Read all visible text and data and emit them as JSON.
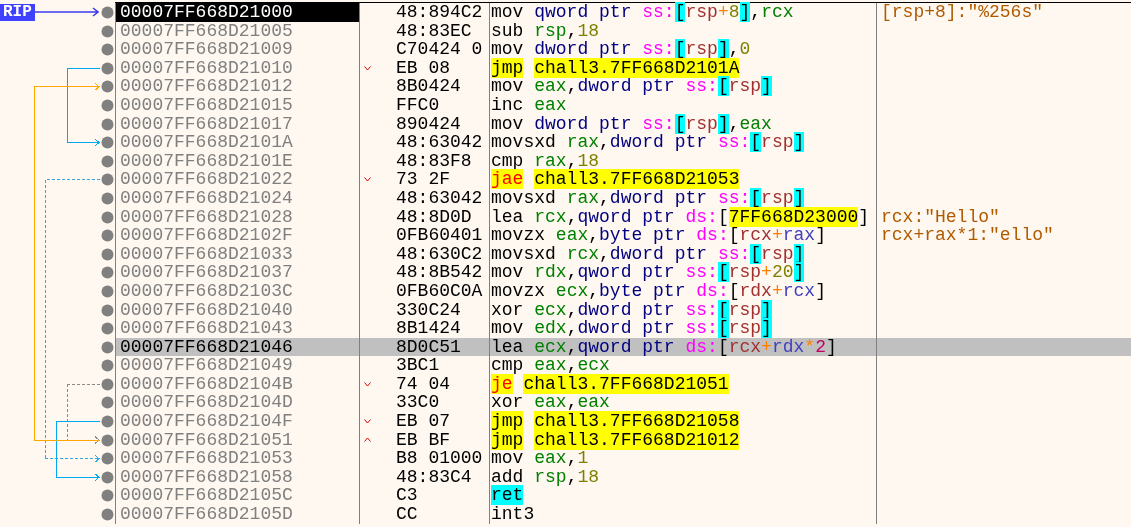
{
  "rows": [
    {
      "label": "RIP",
      "address": "00007FF668D21000",
      "bytes": "48:894C2",
      "selected": true,
      "highlighted": false,
      "tokens": [
        {
          "kind": "m",
          "text": "mov"
        },
        {
          "kind": "sz",
          "text": "qword ptr"
        },
        {
          "kind": "seg",
          "text": "ss:"
        },
        {
          "kind": "bk",
          "text": "["
        },
        {
          "kind": "base",
          "text": "rsp"
        },
        {
          "kind": "op",
          "text": "+"
        },
        {
          "kind": "num",
          "text": "8"
        },
        {
          "kind": "bk",
          "text": "]"
        },
        {
          "kind": "p",
          "text": ","
        },
        {
          "kind": "reg",
          "text": "rcx"
        }
      ],
      "comment": "[rsp+8]:\"%256s\""
    },
    {
      "address": "00007FF668D21005",
      "bytes": "48:83EC",
      "selected": false,
      "highlighted": false,
      "tokens": [
        {
          "kind": "m",
          "text": "sub"
        },
        {
          "kind": "reg",
          "text": "rsp"
        },
        {
          "kind": "p",
          "text": ","
        },
        {
          "kind": "num",
          "text": "18"
        }
      ]
    },
    {
      "address": "00007FF668D21009",
      "bytes": "C70424 0",
      "selected": false,
      "highlighted": false,
      "tokens": [
        {
          "kind": "m",
          "text": "mov"
        },
        {
          "kind": "sz",
          "text": "dword ptr"
        },
        {
          "kind": "seg",
          "text": "ss:"
        },
        {
          "kind": "bk",
          "text": "["
        },
        {
          "kind": "base",
          "text": "rsp"
        },
        {
          "kind": "bk",
          "text": "]"
        },
        {
          "kind": "p",
          "text": ","
        },
        {
          "kind": "num",
          "text": "0"
        }
      ]
    },
    {
      "address": "00007FF668D21010",
      "bytes": "EB 08",
      "selected": false,
      "highlighted": false,
      "jump": {
        "dashed": false,
        "color": "#00a8f0"
      },
      "tokens": [
        {
          "kind": "jmp",
          "text": "jmp"
        },
        {
          "kind": "tgt",
          "text": "chall3.7FF668D2101A"
        }
      ]
    },
    {
      "address": "00007FF668D21012",
      "bytes": "8B0424",
      "selected": false,
      "highlighted": false,
      "tokens": [
        {
          "kind": "m",
          "text": "mov"
        },
        {
          "kind": "reg",
          "text": "eax"
        },
        {
          "kind": "p",
          "text": ","
        },
        {
          "kind": "sz",
          "text": "dword ptr"
        },
        {
          "kind": "seg",
          "text": "ss:"
        },
        {
          "kind": "bk",
          "text": "["
        },
        {
          "kind": "base",
          "text": "rsp"
        },
        {
          "kind": "bk",
          "text": "]"
        }
      ]
    },
    {
      "address": "00007FF668D21015",
      "bytes": "FFC0",
      "selected": false,
      "highlighted": false,
      "tokens": [
        {
          "kind": "m",
          "text": "inc"
        },
        {
          "kind": "reg",
          "text": "eax"
        }
      ]
    },
    {
      "address": "00007FF668D21017",
      "bytes": "890424",
      "selected": false,
      "highlighted": false,
      "tokens": [
        {
          "kind": "m",
          "text": "mov"
        },
        {
          "kind": "sz",
          "text": "dword ptr"
        },
        {
          "kind": "seg",
          "text": "ss:"
        },
        {
          "kind": "bk",
          "text": "["
        },
        {
          "kind": "base",
          "text": "rsp"
        },
        {
          "kind": "bk",
          "text": "]"
        },
        {
          "kind": "p",
          "text": ","
        },
        {
          "kind": "reg",
          "text": "eax"
        }
      ]
    },
    {
      "address": "00007FF668D2101A",
      "bytes": "48:63042",
      "selected": false,
      "highlighted": false,
      "tokens": [
        {
          "kind": "m",
          "text": "movsxd"
        },
        {
          "kind": "reg",
          "text": "rax"
        },
        {
          "kind": "p",
          "text": ","
        },
        {
          "kind": "sz",
          "text": "dword ptr"
        },
        {
          "kind": "seg",
          "text": "ss:"
        },
        {
          "kind": "bk",
          "text": "["
        },
        {
          "kind": "base",
          "text": "rsp"
        },
        {
          "kind": "bk",
          "text": "]"
        }
      ]
    },
    {
      "address": "00007FF668D2101E",
      "bytes": "48:83F8",
      "selected": false,
      "highlighted": false,
      "tokens": [
        {
          "kind": "m",
          "text": "cmp"
        },
        {
          "kind": "reg",
          "text": "rax"
        },
        {
          "kind": "p",
          "text": ","
        },
        {
          "kind": "num",
          "text": "18"
        }
      ]
    },
    {
      "address": "00007FF668D21022",
      "bytes": "73 2F",
      "selected": false,
      "highlighted": false,
      "jump": {
        "dashed": true,
        "color": "#30a8e8"
      },
      "tokens": [
        {
          "kind": "jcc",
          "text": "jae"
        },
        {
          "kind": "tgt",
          "text": "chall3.7FF668D21053"
        }
      ]
    },
    {
      "address": "00007FF668D21024",
      "bytes": "48:63042",
      "selected": false,
      "highlighted": false,
      "tokens": [
        {
          "kind": "m",
          "text": "movsxd"
        },
        {
          "kind": "reg",
          "text": "rax"
        },
        {
          "kind": "p",
          "text": ","
        },
        {
          "kind": "sz",
          "text": "dword ptr"
        },
        {
          "kind": "seg",
          "text": "ss:"
        },
        {
          "kind": "bk",
          "text": "["
        },
        {
          "kind": "base",
          "text": "rsp"
        },
        {
          "kind": "bk",
          "text": "]"
        }
      ]
    },
    {
      "address": "00007FF668D21028",
      "bytes": "48:8D0D",
      "selected": false,
      "highlighted": false,
      "tokens": [
        {
          "kind": "m",
          "text": "lea"
        },
        {
          "kind": "reg",
          "text": "rcx"
        },
        {
          "kind": "p",
          "text": ","
        },
        {
          "kind": "sz",
          "text": "qword ptr"
        },
        {
          "kind": "seg",
          "text": "ds:"
        },
        {
          "kind": "b",
          "text": "["
        },
        {
          "kind": "addr",
          "text": "7FF668D23000"
        },
        {
          "kind": "b",
          "text": "]"
        }
      ],
      "comment": "rcx:\"Hello\""
    },
    {
      "address": "00007FF668D2102F",
      "bytes": "0FB60401",
      "selected": false,
      "highlighted": false,
      "tokens": [
        {
          "kind": "m",
          "text": "movzx"
        },
        {
          "kind": "reg",
          "text": "eax"
        },
        {
          "kind": "p",
          "text": ","
        },
        {
          "kind": "sz",
          "text": "byte ptr"
        },
        {
          "kind": "seg",
          "text": "ds:"
        },
        {
          "kind": "b",
          "text": "["
        },
        {
          "kind": "base",
          "text": "rcx"
        },
        {
          "kind": "op",
          "text": "+"
        },
        {
          "kind": "idx",
          "text": "rax"
        },
        {
          "kind": "b",
          "text": "]"
        }
      ],
      "comment": "rcx+rax*1:\"ello\""
    },
    {
      "address": "00007FF668D21033",
      "bytes": "48:630C2",
      "selected": false,
      "highlighted": false,
      "tokens": [
        {
          "kind": "m",
          "text": "movsxd"
        },
        {
          "kind": "reg",
          "text": "rcx"
        },
        {
          "kind": "p",
          "text": ","
        },
        {
          "kind": "sz",
          "text": "dword ptr"
        },
        {
          "kind": "seg",
          "text": "ss:"
        },
        {
          "kind": "bk",
          "text": "["
        },
        {
          "kind": "base",
          "text": "rsp"
        },
        {
          "kind": "bk",
          "text": "]"
        }
      ]
    },
    {
      "address": "00007FF668D21037",
      "bytes": "48:8B542",
      "selected": false,
      "highlighted": false,
      "tokens": [
        {
          "kind": "m",
          "text": "mov"
        },
        {
          "kind": "reg",
          "text": "rdx"
        },
        {
          "kind": "p",
          "text": ","
        },
        {
          "kind": "sz",
          "text": "qword ptr"
        },
        {
          "kind": "seg",
          "text": "ss:"
        },
        {
          "kind": "bk",
          "text": "["
        },
        {
          "kind": "base",
          "text": "rsp"
        },
        {
          "kind": "op",
          "text": "+"
        },
        {
          "kind": "num",
          "text": "20"
        },
        {
          "kind": "bk",
          "text": "]"
        }
      ]
    },
    {
      "address": "00007FF668D2103C",
      "bytes": "0FB60C0A",
      "selected": false,
      "highlighted": false,
      "tokens": [
        {
          "kind": "m",
          "text": "movzx"
        },
        {
          "kind": "reg",
          "text": "ecx"
        },
        {
          "kind": "p",
          "text": ","
        },
        {
          "kind": "sz",
          "text": "byte ptr"
        },
        {
          "kind": "seg",
          "text": "ds:"
        },
        {
          "kind": "b",
          "text": "["
        },
        {
          "kind": "base",
          "text": "rdx"
        },
        {
          "kind": "op",
          "text": "+"
        },
        {
          "kind": "idx",
          "text": "rcx"
        },
        {
          "kind": "b",
          "text": "]"
        }
      ]
    },
    {
      "address": "00007FF668D21040",
      "bytes": "330C24",
      "selected": false,
      "highlighted": false,
      "tokens": [
        {
          "kind": "m",
          "text": "xor"
        },
        {
          "kind": "reg",
          "text": "ecx"
        },
        {
          "kind": "p",
          "text": ","
        },
        {
          "kind": "sz",
          "text": "dword ptr"
        },
        {
          "kind": "seg",
          "text": "ss:"
        },
        {
          "kind": "bk",
          "text": "["
        },
        {
          "kind": "base",
          "text": "rsp"
        },
        {
          "kind": "bk",
          "text": "]"
        }
      ]
    },
    {
      "address": "00007FF668D21043",
      "bytes": "8B1424",
      "selected": false,
      "highlighted": false,
      "tokens": [
        {
          "kind": "m",
          "text": "mov"
        },
        {
          "kind": "reg",
          "text": "edx"
        },
        {
          "kind": "p",
          "text": ","
        },
        {
          "kind": "sz",
          "text": "dword ptr"
        },
        {
          "kind": "seg",
          "text": "ss:"
        },
        {
          "kind": "bk",
          "text": "["
        },
        {
          "kind": "base",
          "text": "rsp"
        },
        {
          "kind": "bk",
          "text": "]"
        }
      ]
    },
    {
      "address": "00007FF668D21046",
      "bytes": "8D0C51",
      "selected": false,
      "highlighted": true,
      "tokens": [
        {
          "kind": "m",
          "text": "lea"
        },
        {
          "kind": "reg",
          "text": "ecx"
        },
        {
          "kind": "p",
          "text": ","
        },
        {
          "kind": "sz",
          "text": "qword ptr"
        },
        {
          "kind": "seg",
          "text": "ds:"
        },
        {
          "kind": "b",
          "text": "["
        },
        {
          "kind": "base",
          "text": "rcx"
        },
        {
          "kind": "op",
          "text": "+"
        },
        {
          "kind": "idx",
          "text": "rdx"
        },
        {
          "kind": "op",
          "text": "*"
        },
        {
          "kind": "scale",
          "text": "2"
        },
        {
          "kind": "b",
          "text": "]"
        }
      ]
    },
    {
      "address": "00007FF668D21049",
      "bytes": "3BC1",
      "selected": false,
      "highlighted": false,
      "tokens": [
        {
          "kind": "m",
          "text": "cmp"
        },
        {
          "kind": "reg",
          "text": "eax"
        },
        {
          "kind": "p",
          "text": ","
        },
        {
          "kind": "reg",
          "text": "ecx"
        }
      ]
    },
    {
      "address": "00007FF668D2104B",
      "bytes": "74 04",
      "selected": false,
      "highlighted": false,
      "jump": {
        "dashed": true,
        "color": "#8a8a8a"
      },
      "tokens": [
        {
          "kind": "jcc",
          "text": "je"
        },
        {
          "kind": "tgt",
          "text": "chall3.7FF668D21051"
        }
      ]
    },
    {
      "address": "00007FF668D2104D",
      "bytes": "33C0",
      "selected": false,
      "highlighted": false,
      "tokens": [
        {
          "kind": "m",
          "text": "xor"
        },
        {
          "kind": "reg",
          "text": "eax"
        },
        {
          "kind": "p",
          "text": ","
        },
        {
          "kind": "reg",
          "text": "eax"
        }
      ]
    },
    {
      "address": "00007FF668D2104F",
      "bytes": "EB 07",
      "selected": false,
      "highlighted": false,
      "jump": {
        "dashed": false,
        "color": "#00a8f0"
      },
      "tokens": [
        {
          "kind": "jmp",
          "text": "jmp"
        },
        {
          "kind": "tgt",
          "text": "chall3.7FF668D21058"
        }
      ]
    },
    {
      "address": "00007FF668D21051",
      "bytes": "EB BF",
      "selected": false,
      "highlighted": false,
      "jump": {
        "dashed": false,
        "color": "#ffa500"
      },
      "tokens": [
        {
          "kind": "jmp",
          "text": "jmp"
        },
        {
          "kind": "tgt",
          "text": "chall3.7FF668D21012"
        }
      ]
    },
    {
      "address": "00007FF668D21053",
      "bytes": "B8 01000",
      "selected": false,
      "highlighted": false,
      "tokens": [
        {
          "kind": "m",
          "text": "mov"
        },
        {
          "kind": "reg",
          "text": "eax"
        },
        {
          "kind": "p",
          "text": ","
        },
        {
          "kind": "num",
          "text": "1"
        }
      ]
    },
    {
      "address": "00007FF668D21058",
      "bytes": "48:83C4",
      "selected": false,
      "highlighted": false,
      "tokens": [
        {
          "kind": "m",
          "text": "add"
        },
        {
          "kind": "reg",
          "text": "rsp"
        },
        {
          "kind": "p",
          "text": ","
        },
        {
          "kind": "num",
          "text": "18"
        }
      ]
    },
    {
      "address": "00007FF668D2105C",
      "bytes": "C3",
      "selected": false,
      "highlighted": false,
      "tokens": [
        {
          "kind": "ret",
          "text": "ret"
        }
      ]
    },
    {
      "address": "00007FF668D2105D",
      "bytes": "CC",
      "selected": false,
      "highlighted": false,
      "tokens": [
        {
          "kind": "m",
          "text": "int3"
        }
      ]
    }
  ]
}
